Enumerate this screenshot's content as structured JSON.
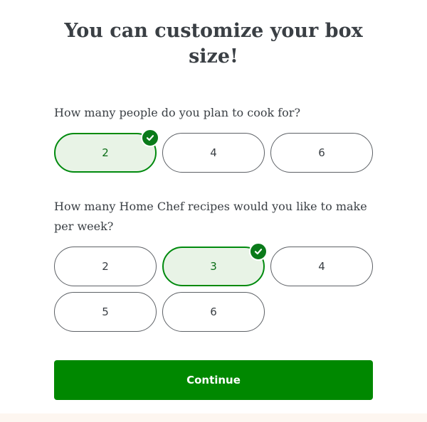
{
  "title": "You can customize your box size!",
  "people_question": {
    "label": "How many people do you plan to cook for?",
    "options": [
      "2",
      "4",
      "6"
    ],
    "selected": "2"
  },
  "recipes_question": {
    "label": "How many Home Chef recipes would you like to make per week?",
    "options": [
      "2",
      "3",
      "4",
      "5",
      "6"
    ],
    "selected": "3"
  },
  "continue_label": "Continue",
  "colors": {
    "accent": "#008800",
    "selected_bg": "#e8f3e6",
    "text": "#3a3f44"
  }
}
